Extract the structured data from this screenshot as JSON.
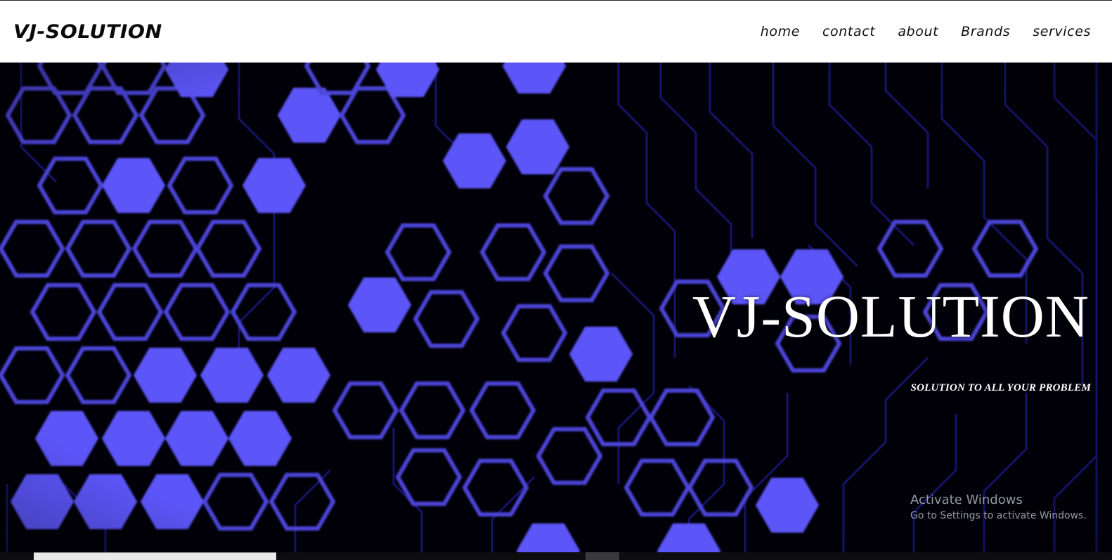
{
  "nav": {
    "brand": "VJ-SOLUTION",
    "links": [
      "home",
      "contact",
      "about",
      "Brands",
      "services"
    ]
  },
  "hero": {
    "title": "VJ-SOLUTION",
    "tagline": "SOLUTION TO ALL YOUR PROBLEM"
  },
  "watermark": {
    "title": "Activate Windows",
    "subtitle": "Go to Settings to activate Windows."
  },
  "colors": {
    "hex_fill": "#5b55f7",
    "hex_outline": "#4b45d8",
    "circuit": "#15136b",
    "background": "#010008"
  }
}
